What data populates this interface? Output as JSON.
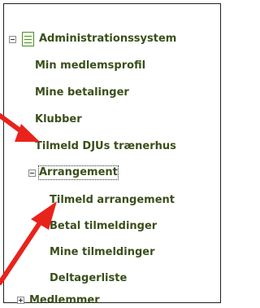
{
  "tree": {
    "root": {
      "label": "Administrationssystem"
    },
    "items": [
      {
        "label": "Min medlemsprofil"
      },
      {
        "label": "Mine betalinger"
      },
      {
        "label": "Klubber"
      },
      {
        "label": "Tilmeld DJUs trænerhus"
      }
    ],
    "arrangement": {
      "label": "Arrangement",
      "children": [
        {
          "label": "Tilmeld arrangement"
        },
        {
          "label": "Betal tilmeldinger"
        },
        {
          "label": "Mine tilmeldinger"
        },
        {
          "label": "Deltagerliste"
        }
      ]
    },
    "medlemmer": {
      "label": "Medlemmer"
    }
  },
  "colors": {
    "text": "#3a4f1a",
    "arrow": "#e8231c",
    "border": "#1f1f1f"
  }
}
